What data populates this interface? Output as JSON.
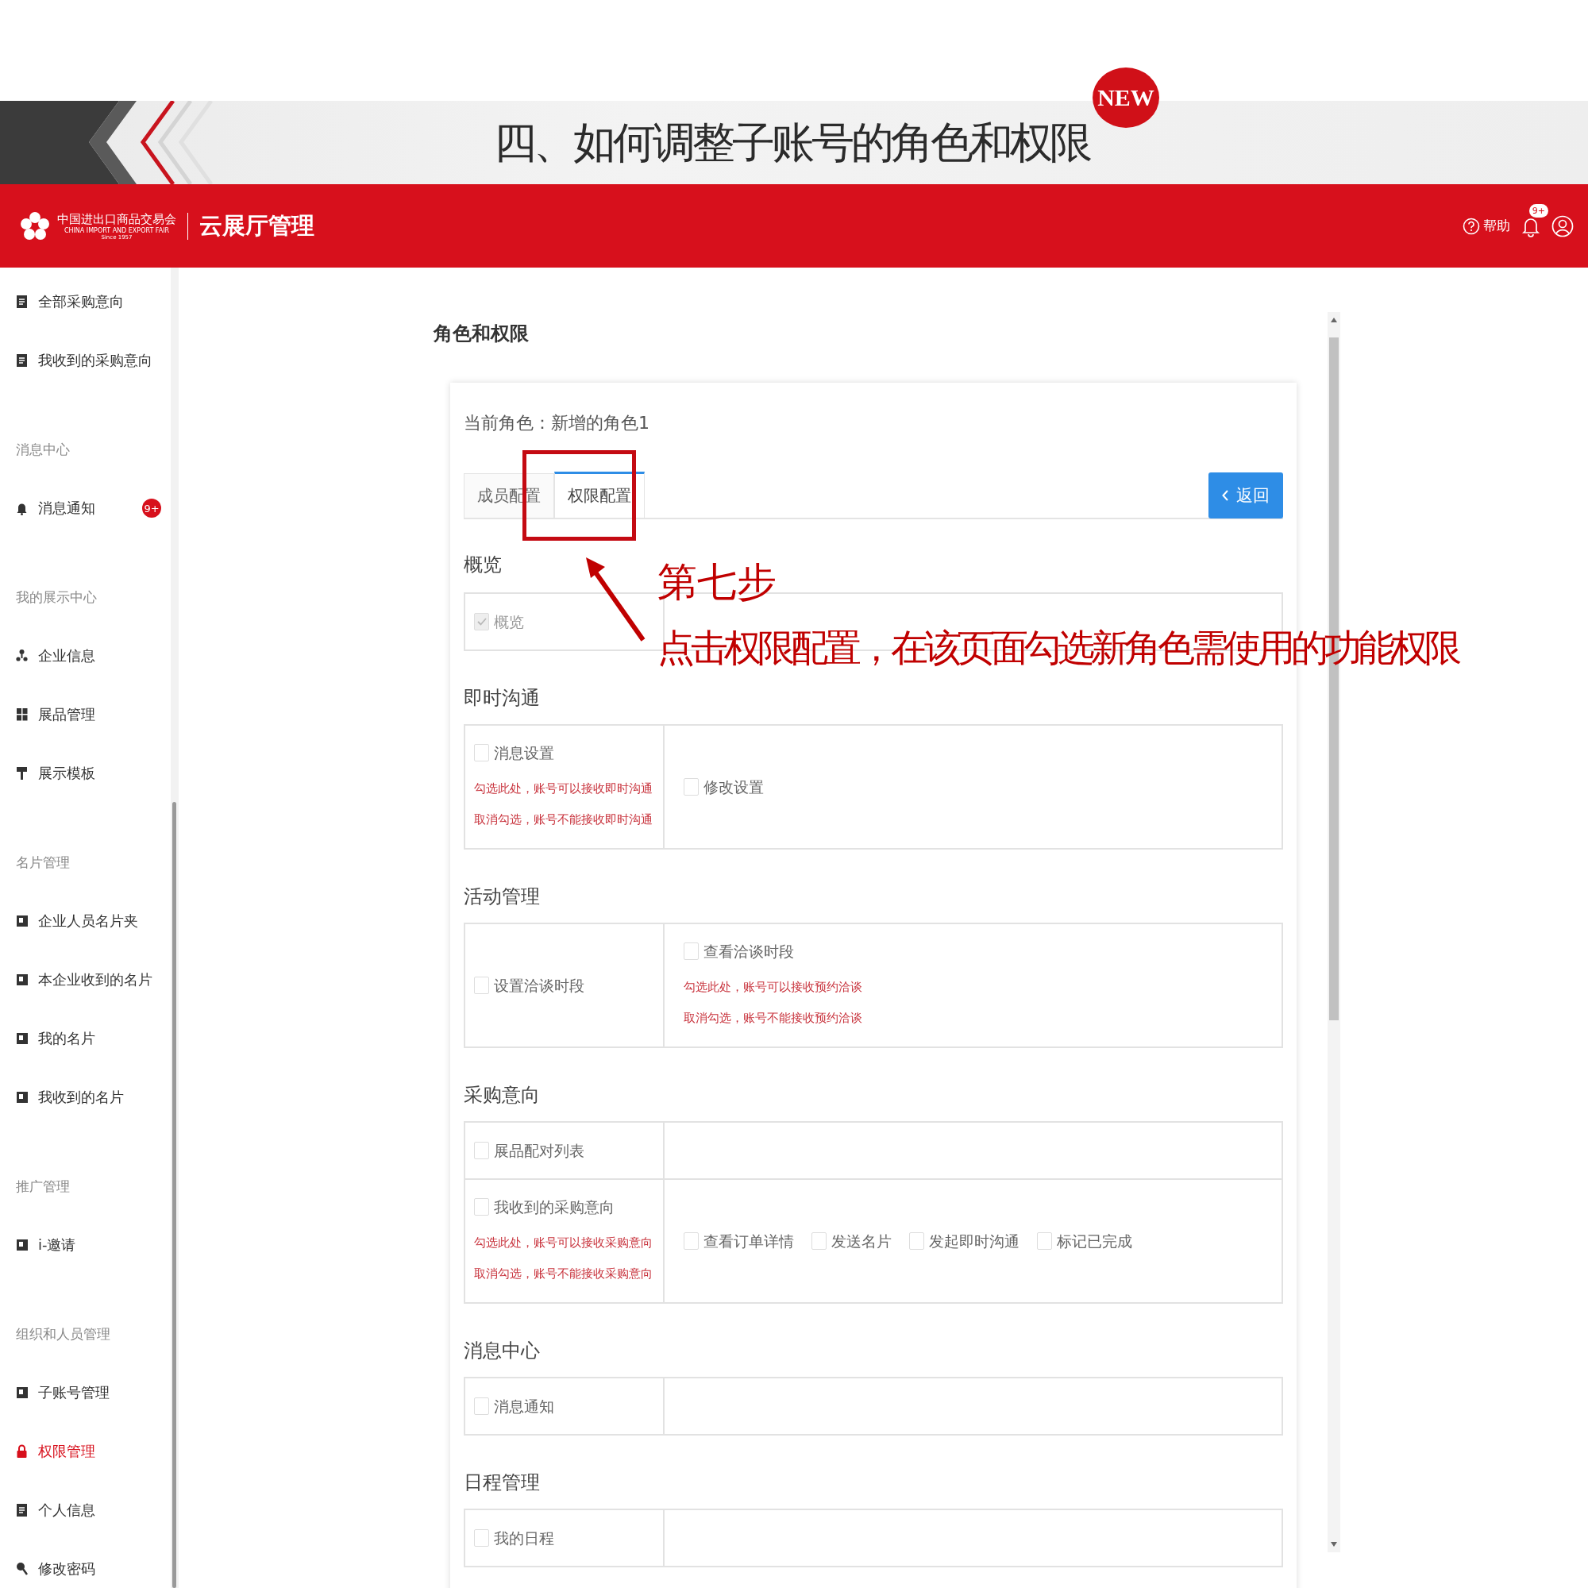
{
  "slide": {
    "title": "四、如何调整子账号的角色和权限",
    "new_badge": "NEW"
  },
  "header": {
    "logo_cn": "中国进出口商品交易会",
    "logo_en": "CHINA IMPORT AND EXPORT FAIR",
    "logo_since": "Since 1957",
    "app_name": "云展厅管理",
    "help": "帮助",
    "notification_count": "9+"
  },
  "sidebar": {
    "items": [
      {
        "kind": "item",
        "label": "全部采购意向",
        "selected": false
      },
      {
        "kind": "item",
        "label": "我收到的采购意向",
        "selected": false
      },
      {
        "kind": "group",
        "label": "消息中心"
      },
      {
        "kind": "item",
        "label": "消息通知",
        "selected": false,
        "badge": "9+"
      },
      {
        "kind": "group",
        "label": "我的展示中心"
      },
      {
        "kind": "item",
        "label": "企业信息",
        "selected": false
      },
      {
        "kind": "item",
        "label": "展品管理",
        "selected": false
      },
      {
        "kind": "item",
        "label": "展示模板",
        "selected": false
      },
      {
        "kind": "group",
        "label": "名片管理"
      },
      {
        "kind": "item",
        "label": "企业人员名片夹",
        "selected": false
      },
      {
        "kind": "item",
        "label": "本企业收到的名片",
        "selected": false
      },
      {
        "kind": "item",
        "label": "我的名片",
        "selected": false
      },
      {
        "kind": "item",
        "label": "我收到的名片",
        "selected": false
      },
      {
        "kind": "group",
        "label": "推广管理"
      },
      {
        "kind": "item",
        "label": "i-邀请",
        "selected": false
      },
      {
        "kind": "group",
        "label": "组织和人员管理"
      },
      {
        "kind": "item",
        "label": "子账号管理",
        "selected": false
      },
      {
        "kind": "item",
        "label": "权限管理",
        "selected": true
      },
      {
        "kind": "item",
        "label": "个人信息",
        "selected": false
      },
      {
        "kind": "item",
        "label": "修改密码",
        "selected": false
      }
    ]
  },
  "content": {
    "page_title": "角色和权限",
    "current_role": "当前角色：新增的角色1",
    "tabs": [
      {
        "label": "成员配置",
        "selected": false
      },
      {
        "label": "权限配置",
        "selected": true
      }
    ],
    "back_button": "返回",
    "sections": [
      {
        "title": "概览",
        "rows": [
          {
            "cells": [
              {
                "items": [
                  {
                    "label": "概览",
                    "checked": true,
                    "disabled": true
                  }
                ]
              },
              {}
            ]
          }
        ]
      },
      {
        "title": "即时沟通",
        "rows": [
          {
            "cells": [
              {
                "items": [
                  {
                    "label": "消息设置",
                    "checked": false,
                    "disabled": false
                  }
                ],
                "notes": [
                  "勾选此处，账号可以接收即时沟通",
                  "取消勾选，账号不能接收即时沟通"
                ]
              },
              {
                "items": [
                  {
                    "label": "修改设置",
                    "checked": false,
                    "disabled": false
                  }
                ]
              }
            ]
          }
        ]
      },
      {
        "title": "活动管理",
        "rows": [
          {
            "cells": [
              {
                "items": [
                  {
                    "label": "设置洽谈时段",
                    "checked": false,
                    "disabled": false
                  }
                ]
              },
              {
                "items": [
                  {
                    "label": "查看洽谈时段",
                    "checked": false,
                    "disabled": false
                  }
                ],
                "notes": [
                  "勾选此处，账号可以接收预约洽谈",
                  "取消勾选，账号不能接收预约洽谈"
                ]
              }
            ]
          }
        ]
      },
      {
        "title": "采购意向",
        "rows": [
          {
            "cells": [
              {
                "items": [
                  {
                    "label": "展品配对列表",
                    "checked": false,
                    "disabled": false
                  }
                ]
              },
              {}
            ]
          },
          {
            "cells": [
              {
                "items": [
                  {
                    "label": "我收到的采购意向",
                    "checked": false,
                    "disabled": false
                  }
                ],
                "notes": [
                  "勾选此处，账号可以接收采购意向",
                  "取消勾选，账号不能接收采购意向"
                ]
              },
              {
                "items": [
                  {
                    "label": "查看订单详情",
                    "checked": false,
                    "disabled": false
                  },
                  {
                    "label": "发送名片",
                    "checked": false,
                    "disabled": false
                  },
                  {
                    "label": "发起即时沟通",
                    "checked": false,
                    "disabled": false
                  },
                  {
                    "label": "标记已完成",
                    "checked": false,
                    "disabled": false
                  }
                ]
              }
            ]
          }
        ]
      },
      {
        "title": "消息中心",
        "rows": [
          {
            "cells": [
              {
                "items": [
                  {
                    "label": "消息通知",
                    "checked": false,
                    "disabled": false
                  }
                ]
              },
              {}
            ]
          }
        ]
      },
      {
        "title": "日程管理",
        "rows": [
          {
            "cells": [
              {
                "items": [
                  {
                    "label": "我的日程",
                    "checked": false,
                    "disabled": false
                  }
                ]
              },
              {}
            ]
          }
        ]
      }
    ]
  },
  "annotation": {
    "step": "第七步",
    "instruction": "点击权限配置，在该页面勾选新角色需使用的功能权限"
  }
}
